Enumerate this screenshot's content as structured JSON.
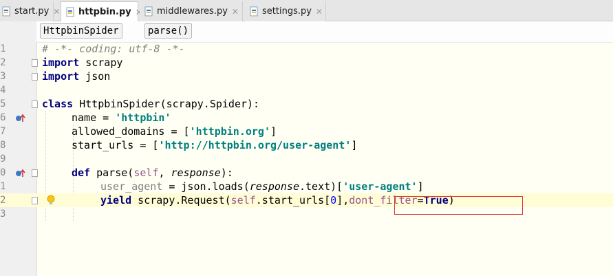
{
  "tabs": [
    {
      "label": "start.py",
      "active": false
    },
    {
      "label": "httpbin.py",
      "active": true
    },
    {
      "label": "middlewares.py",
      "active": false
    },
    {
      "label": "settings.py",
      "active": false
    }
  ],
  "breadcrumb": [
    "HttpbinSpider",
    "parse()"
  ],
  "line_numbers": [
    "1",
    "2",
    "3",
    "4",
    "5",
    "6",
    "7",
    "8",
    "9",
    "0",
    "1",
    "2",
    "3"
  ],
  "code": {
    "l1": "# -*- coding: utf-8 -*-",
    "l2_kw": "import",
    "l2_rest": " scrapy",
    "l3_kw": "import",
    "l3_rest": " json",
    "l5_kw": "class",
    "l5_name": "HttpbinSpider",
    "l5_rest": "(scrapy.Spider):",
    "l6_a": "name = ",
    "l6_s": "'httpbin'",
    "l7_a": "allowed_domains = [",
    "l7_s": "'httpbin.org'",
    "l7_b": "]",
    "l8_a": "start_urls = [",
    "l8_s": "'http://httpbin.org/user-agent'",
    "l8_b": "]",
    "l10_kw": "def",
    "l10_name": "parse",
    "l10_a": "(",
    "l10_self": "self",
    "l10_b": ", ",
    "l10_param": "response",
    "l10_c": "):",
    "l11_a": "user_agent",
    "l11_b": " = json.loads(",
    "l11_param": "response",
    "l11_c": ".text)[",
    "l11_s": "'user-agent'",
    "l11_d": "]",
    "l12_kw": "yield",
    "l12_a": " scrapy.Request(",
    "l12_self": "self",
    "l12_b": ".start_urls[",
    "l12_num": "0",
    "l12_c": "],",
    "l12_kwarg": "dont_filter",
    "l12_eq": "=",
    "l12_true": "True",
    "l12_d": ")"
  },
  "colors": {
    "keyword": "#000080",
    "string": "#008080",
    "comment": "#808080",
    "self": "#94558d",
    "highlight_box": "#e53b3b"
  },
  "icons": {
    "file_tab": "python-file-icon",
    "override": "override-icon",
    "fold": "fold-marker-icon",
    "intention": "lightbulb-icon"
  }
}
